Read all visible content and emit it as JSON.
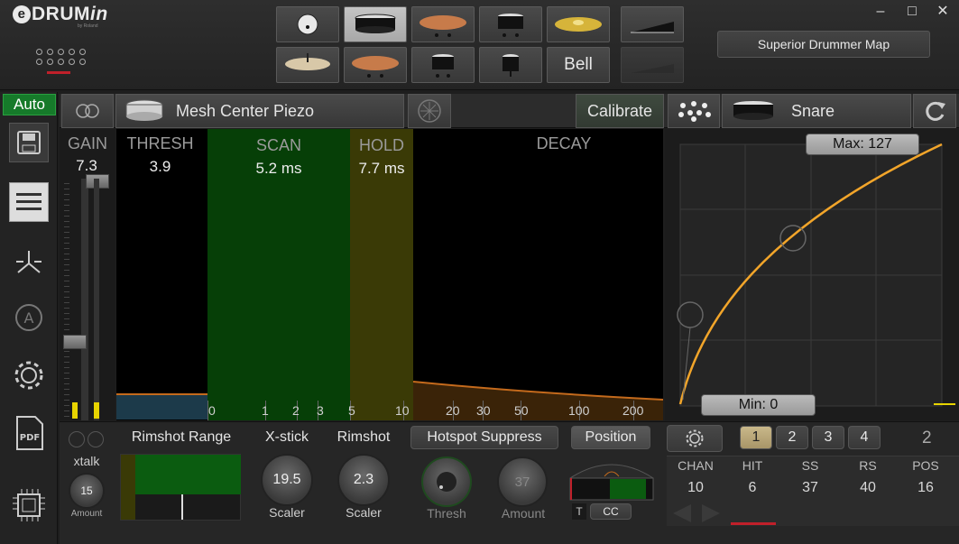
{
  "app": {
    "logo_e": "e",
    "logo_drum": "DRUM",
    "logo_in": "in",
    "logo_sub": "by Roland"
  },
  "topbar": {
    "kit_bell_label": "Bell",
    "map_button": "Superior Drummer Map",
    "minimize": "–",
    "maximize": "□",
    "close": "✕"
  },
  "sidebar": {
    "auto": "Auto"
  },
  "header": {
    "trigger_name": "Mesh Center Piezo",
    "calibrate": "Calibrate",
    "instrument": "Snare"
  },
  "graph": {
    "gain_label": "GAIN",
    "gain_value": "7.3",
    "thresh_label": "THRESH",
    "thresh_value": "3.9",
    "scan_label": "SCAN",
    "scan_value": "5.2 ms",
    "hold_label": "HOLD",
    "hold_value": "7.7 ms",
    "decay_label": "DECAY",
    "axis_ticks": [
      "0",
      "1",
      "2",
      "3",
      "5",
      "10",
      "20",
      "30",
      "50",
      "100",
      "200"
    ]
  },
  "curve": {
    "max_label": "Max: 127",
    "min_label": "Min: 0"
  },
  "bottom": {
    "xtalk_label": "xtalk",
    "xtalk_value": "15",
    "xtalk_sub": "Amount",
    "rimshot_range": "Rimshot Range",
    "xstick_label": "X-stick",
    "xstick_value": "19.5",
    "xstick_sub": "Scaler",
    "rimshot_label": "Rimshot",
    "rimshot_value": "2.3",
    "rimshot_sub": "Scaler",
    "hotspot": "Hotspot Suppress",
    "position": "Position",
    "thresh_sub": "Thresh",
    "amount_value": "37",
    "amount_sub": "Amount",
    "t_label": "T",
    "cc_label": "CC",
    "pages": [
      "1",
      "2",
      "3",
      "4"
    ],
    "page_total": "2",
    "midi": {
      "chan_label": "CHAN",
      "chan_value": "10",
      "hit_label": "HIT",
      "hit_value": "6",
      "ss_label": "SS",
      "ss_value": "37",
      "rs_label": "RS",
      "rs_value": "40",
      "pos_label": "POS",
      "pos_value": "16"
    }
  },
  "colors": {
    "accent_green": "#167a2a",
    "scan_green": "#063f07",
    "hold_olive": "#3a3a06",
    "curve_orange": "#f2a52a",
    "meter_yellow": "#e8d400",
    "alert_red": "#c0202a"
  }
}
